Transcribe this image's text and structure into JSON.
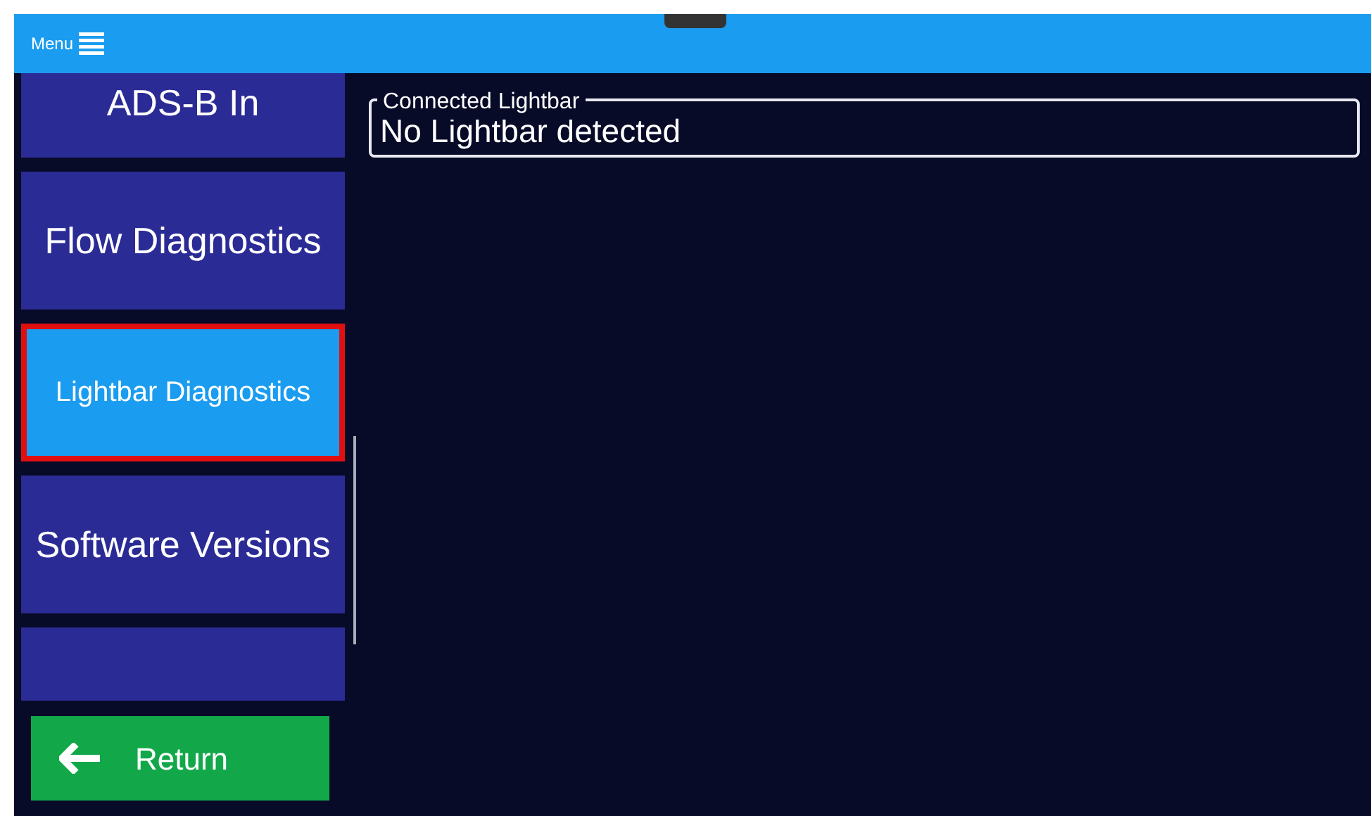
{
  "header": {
    "menu_label": "Menu"
  },
  "sidebar": {
    "items": [
      {
        "label": "ADS-B In",
        "selected": false
      },
      {
        "label": "Flow Diagnostics",
        "selected": false
      },
      {
        "label": "Lightbar Diagnostics",
        "selected": true
      },
      {
        "label": "Software Versions",
        "selected": false
      },
      {
        "selected": false
      }
    ],
    "return_button": "Return"
  },
  "panel": {
    "legend": "Connected Lightbar",
    "value": "No Lightbar detected"
  }
}
